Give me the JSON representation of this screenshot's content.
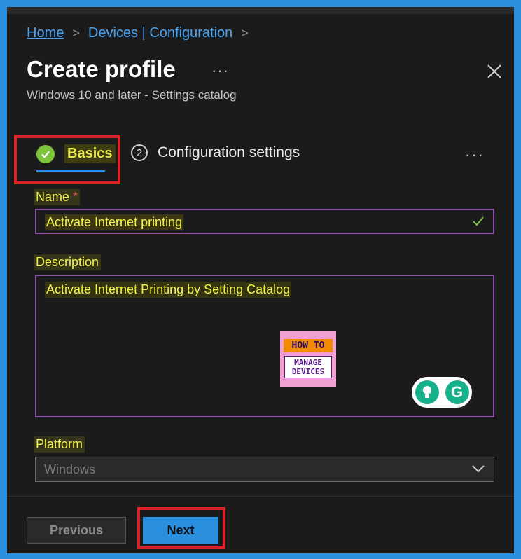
{
  "breadcrumb": {
    "home": "Home",
    "devices": "Devices | Configuration",
    "separator": ">"
  },
  "header": {
    "title": "Create profile",
    "more": "···",
    "subtitle": "Windows 10 and later - Settings catalog"
  },
  "tabs": {
    "basics_label": "Basics",
    "config_step": "2",
    "config_label": "Configuration settings",
    "more": "···"
  },
  "form": {
    "name_label": "Name",
    "required_mark": "*",
    "name_value": "Activate Internet printing",
    "description_label": "Description",
    "description_value": "Activate Internet Printing by Setting Catalog",
    "platform_label": "Platform",
    "platform_value": "Windows"
  },
  "watermark": {
    "line1": "HOW TO",
    "line2": "MANAGE",
    "line3": "DEVICES"
  },
  "grammarly": {
    "g_letter": "G"
  },
  "footer": {
    "previous_label": "Previous",
    "next_label": "Next"
  },
  "colors": {
    "accent": "#2b8fe0",
    "highlight_box": "#d8232a",
    "field_border": "#8a4fa8",
    "success": "#7cc43a"
  }
}
